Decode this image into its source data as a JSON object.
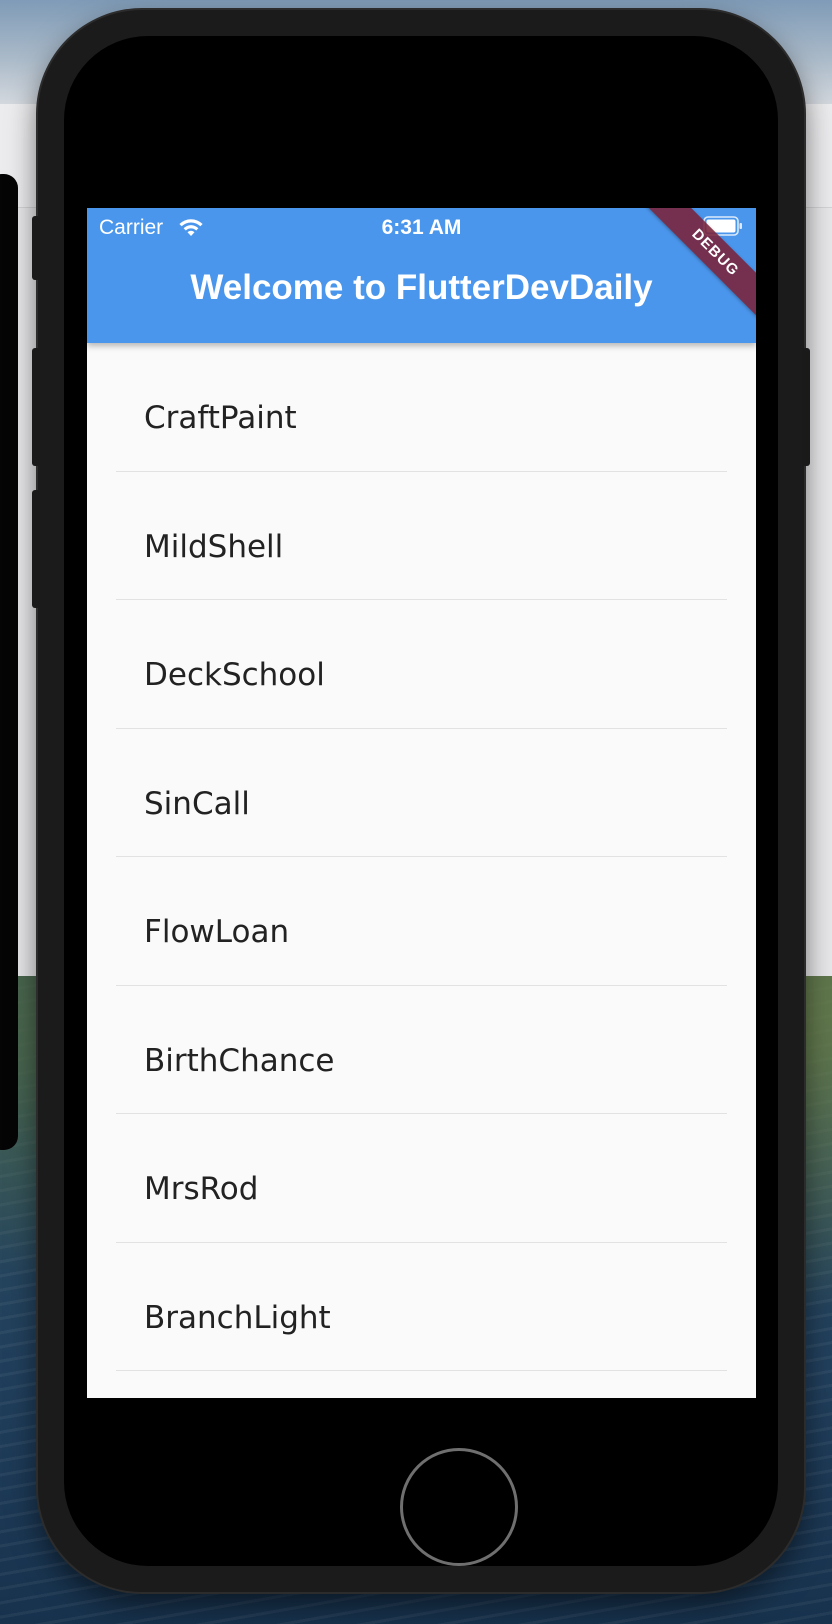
{
  "status_bar": {
    "carrier": "Carrier",
    "time": "6:31 AM",
    "wifi_icon": "wifi-icon",
    "battery_icon": "battery-icon"
  },
  "app_bar": {
    "title": "Welcome to FlutterDevDaily",
    "color": "#4a96ec"
  },
  "debug_banner": "DEBUG",
  "list": {
    "items": [
      "CraftPaint",
      "MildShell",
      "DeckSchool",
      "SinCall",
      "FlowLoan",
      "BirthChance",
      "MrsRod",
      "BranchLight"
    ]
  }
}
